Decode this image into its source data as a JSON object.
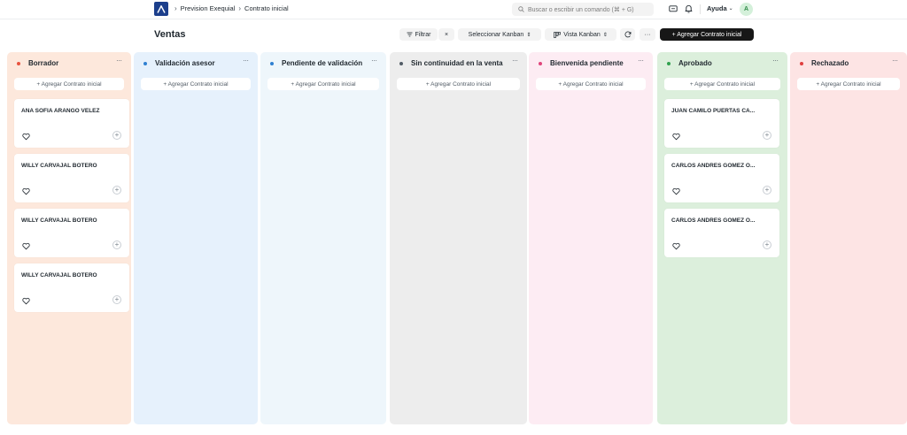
{
  "navbar": {
    "breadcrumbs": [
      "Prevision Exequial",
      "Contrato inicial"
    ],
    "search_placeholder": "Buscar o escribir un comando (⌘ + G)",
    "help_label": "Ayuda",
    "avatar_initial": "A"
  },
  "page": {
    "title": "Ventas",
    "filter_label": "Filtrar",
    "clear_symbol": "×",
    "select_kanban_label": "Seleccionar Kanban",
    "view_kanban_label": "Vista Kanban",
    "more_symbol": "···",
    "add_button_label": "+ Agregar Contrato inicial"
  },
  "board": {
    "add_card_label": "+ Agregar Contrato inicial",
    "columns": [
      {
        "title": "Borrador",
        "bg": "#fde8dc",
        "dot": "#e8533f",
        "cards": [
          "ANA SOFIA ARANGO VELEZ",
          "WILLY CARVAJAL BOTERO",
          "WILLY CARVAJAL BOTERO",
          "WILLY CARVAJAL BOTERO"
        ]
      },
      {
        "title": "Validación asesor",
        "bg": "#e6f1fc",
        "dot": "#2f80d1",
        "cards": []
      },
      {
        "title": "Pendiente de validación",
        "bg": "#eef6fb",
        "dot": "#2f80d1",
        "cards": []
      },
      {
        "title": "Sin continuidad en la venta",
        "bg": "#ededed",
        "dot": "#525c66",
        "cards": []
      },
      {
        "title": "Bienvenida pendiente",
        "bg": "#fdecf3",
        "dot": "#e0457b",
        "cards": []
      },
      {
        "title": "Aprobado",
        "bg": "#dcefdc",
        "dot": "#30a14e",
        "cards": [
          "JUAN CAMILO PUERTAS CA...",
          "CARLOS ANDRES GOMEZ O...",
          "CARLOS ANDRES GOMEZ O..."
        ]
      },
      {
        "title": "Rechazado",
        "bg": "#fde4e4",
        "dot": "#e03e3e",
        "cards": []
      }
    ]
  }
}
